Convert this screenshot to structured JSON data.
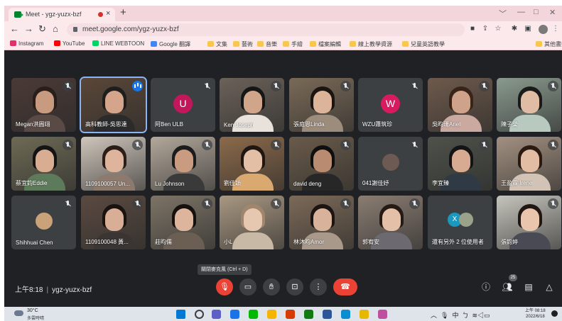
{
  "browser": {
    "tab_title": "Meet - ygz-yuzx-bzf",
    "tab_close": "×",
    "new_tab": "+",
    "url": "meet.google.com/ygz-yuzx-bzf",
    "window_controls": [
      "﹀",
      "—",
      "□",
      "✕"
    ]
  },
  "bookmarks": [
    {
      "label": "Instagram",
      "color": "#e1306c"
    },
    {
      "label": "YouTube",
      "color": "#ff0000"
    },
    {
      "label": "LINE WEBTOON",
      "color": "#00d564"
    },
    {
      "label": "Google 翻譯",
      "color": "#4285f4"
    },
    {
      "label": "文集",
      "color": "#f9c74f"
    },
    {
      "label": "藝術",
      "color": "#f9c74f"
    },
    {
      "label": "音樂",
      "color": "#f9c74f"
    },
    {
      "label": "手繪",
      "color": "#f9c74f"
    },
    {
      "label": "檔案編輯",
      "color": "#f9c74f"
    },
    {
      "label": "線上教學資源",
      "color": "#f9c74f"
    },
    {
      "label": "兒童英語教學",
      "color": "#f9c74f"
    },
    {
      "label": "其他書籤",
      "color": "#f9c74f"
    }
  ],
  "participants": [
    {
      "name": "Megan洪圓翊",
      "bg": "#4a3a36",
      "skin": "#c89a80",
      "hair": "#2a1e1a",
      "shirt": "#5a4a46"
    },
    {
      "name": "高科教師-吳思達",
      "bg": "#5a4738",
      "skin": "#d4a58a",
      "hair": "#1e1e1e",
      "shirt": "#2b2b2b",
      "speaking": true
    },
    {
      "name": "阿Ben ULB",
      "letter": "U",
      "letter_bg": "#c2185b"
    },
    {
      "name": "Ken Joseph",
      "bg": "#6b6259",
      "skin": "#d1a58a",
      "hair": "#161616",
      "shirt": "#e8e2da"
    },
    {
      "name": "張庭恩Linda",
      "bg": "#7a6a57",
      "skin": "#dcb49a",
      "hair": "#1b1410",
      "shirt": "#9c8c7c"
    },
    {
      "name": "WZU蕭筑珍",
      "letter": "W",
      "letter_bg": "#d81b60"
    },
    {
      "name": "吳昀珊Ariel",
      "bg": "#6e5a4c",
      "skin": "#cfa28a",
      "hair": "#3a2418",
      "shirt": "#c9a9a0"
    },
    {
      "name": "陳子榮",
      "bg": "#8a9a8e",
      "skin": "#e0bca4",
      "hair": "#1a1a1a",
      "shirt": "#b8c9c0"
    },
    {
      "name": "蔡宜鈞Eddie",
      "bg": "#6e6a55",
      "skin": "#d8ad92",
      "hair": "#141414",
      "shirt": "#5d7a5a"
    },
    {
      "name": "1109100057 Un...",
      "bg": "#cfc6bb",
      "skin": "#dfb49c",
      "hair": "#2b1d18",
      "shirt": "#8d7a6e"
    },
    {
      "name": "Lu Johnson",
      "bg": "#b3a89b",
      "skin": "#c99c82",
      "hair": "#1c1c1c",
      "shirt": "#3a3a3a"
    },
    {
      "name": "劉佳穎",
      "bg": "#8c6a4a",
      "skin": "#e3bfa5",
      "hair": "#201712",
      "shirt": "#d9a96f"
    },
    {
      "name": "david deng",
      "bg": "#6a5b4a",
      "skin": "#b98b70",
      "hair": "#0f0f0f",
      "shirt": "#272727"
    },
    {
      "name": "041謝佳妤",
      "avatar_bg": "#6d5a52"
    },
    {
      "name": "李宜臻",
      "bg": "#4e524a",
      "skin": "#d6ab92",
      "hair": "#141414",
      "shirt": "#2f3a44"
    },
    {
      "name": "王盈霖 Irene",
      "bg": "#a39181",
      "skin": "#e2bca3",
      "hair": "#2a1a12",
      "shirt": "#d2c3b6"
    },
    {
      "name": "Shihhuai Chen",
      "avatar_bg": "#c9a27a"
    },
    {
      "name": "1109100048 黃...",
      "bg": "#5a4a40",
      "skin": "#d8ae96",
      "hair": "#1a1310",
      "shirt": "#3a3433"
    },
    {
      "name": "莊昀儒",
      "bg": "#7d7466",
      "skin": "#ddb59c",
      "hair": "#16110e",
      "shirt": "#6b5e52"
    },
    {
      "name": "小L",
      "bg": "#a99882",
      "skin": "#e6c7b0",
      "hair": "#a0866c",
      "shirt": "#c8b8a6"
    },
    {
      "name": "林沐昀Amor",
      "bg": "#7c6a58",
      "skin": "#d9b29b",
      "hair": "#1d1511",
      "shirt": "#a8998a"
    },
    {
      "name": "郭宥安",
      "bg": "#8a7d72",
      "skin": "#e4c0a8",
      "hair": "#261a14",
      "shirt": "#6c6a70"
    },
    {
      "name": "還有另外 2 位使用者",
      "others": true
    },
    {
      "name": "張鈞婷",
      "bg": "#c5c4bc",
      "skin": "#e8c5ac",
      "hair": "#201712",
      "shirt": "#4a4a55"
    }
  ],
  "tooltip": "關閉麥克風 (Ctrl + D)",
  "meeting": {
    "time": "上午8:18",
    "separator": "|",
    "code": "ygz-yuzx-bzf",
    "people_count": "25"
  },
  "taskbar": {
    "weather_temp": "30°C",
    "weather_desc": "多雲時晴",
    "ime_lang": "中",
    "clock_time": "上午 08:18",
    "clock_date": "2022/6/18",
    "apps": [
      "#0078d4",
      "#3c4043",
      "#5b5fc7",
      "#1a73e8",
      "#00b900",
      "#f4b400",
      "#d83b01",
      "#107c10",
      "#2b579a",
      "#0b8ed1",
      "#e8b800",
      "#c04ea0"
    ]
  }
}
